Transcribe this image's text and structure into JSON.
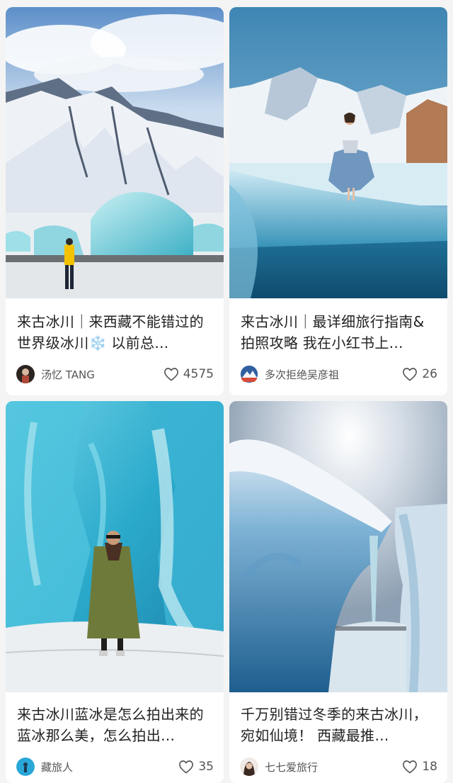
{
  "feed": {
    "cards": [
      {
        "title": "来古冰川｜来西藏不能错过的世界级冰川❄️ 以前总…",
        "author": "汤忆 TANG",
        "likes": "4575",
        "image": "glacier-hiker-yellow-jacket"
      },
      {
        "title": "来古冰川｜最详细旅行指南&拍照攻略 我在小红书上…",
        "author": "多次拒绝吴彦祖",
        "likes": "26",
        "image": "woman-blue-dress-on-ice"
      },
      {
        "title": "来古冰川蓝冰是怎么拍出来的 蓝冰那么美，怎么拍出…",
        "author": "藏旅人",
        "likes": "35",
        "image": "man-green-coat-ice-cave"
      },
      {
        "title": "千万别错过冬季的来古冰川，宛如仙境！ 西藏最推…",
        "author": "七七爱旅行",
        "likes": "18",
        "image": "blue-ice-arch-icicle"
      }
    ],
    "colors": {
      "background": "#f4f4f4",
      "card": "#ffffff",
      "text": "#222222",
      "meta": "#555555"
    },
    "icons": {
      "like": "heart-outline-icon"
    }
  }
}
